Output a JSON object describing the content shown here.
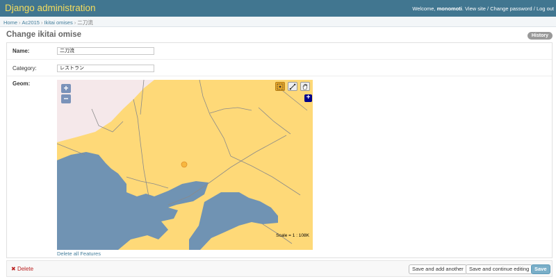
{
  "header": {
    "site_title": "Django administration",
    "welcome": "Welcome,",
    "username": "monomoti",
    "view_site": "View site",
    "change_password": "Change password",
    "log_out": "Log out",
    "separator": "/"
  },
  "breadcrumbs": {
    "items": [
      "Home",
      "Ac2015",
      "Ikitai omises"
    ],
    "current": "二刀流",
    "separator": "›"
  },
  "page": {
    "title": "Change ikitai omise",
    "history_label": "History"
  },
  "form": {
    "name": {
      "label": "Name:",
      "value": "二刀流"
    },
    "category": {
      "label": "Category:",
      "value": "レストラン"
    },
    "geom": {
      "label": "Geom:"
    }
  },
  "map": {
    "zoom_in": "+",
    "zoom_out": "−",
    "layer_switcher": "+",
    "scale": "Scale = 1 : 108K",
    "delete_all": "Delete all Features",
    "colors": {
      "land": "#fed978",
      "water": "#7093b3",
      "other_land": "#f5e8ea",
      "road": "#8a8a8a",
      "point": "#f7b73f"
    }
  },
  "submit": {
    "delete_icon": "✖",
    "delete_label": "Delete",
    "save_add_another": "Save and add another",
    "save_continue": "Save and continue editing",
    "save": "Save"
  },
  "colors": {
    "header_bg": "#417690",
    "title_yellow": "#f5dd5d",
    "link": "#447e9b",
    "delete_red": "#ba2121",
    "save_blue": "#79aec8"
  }
}
